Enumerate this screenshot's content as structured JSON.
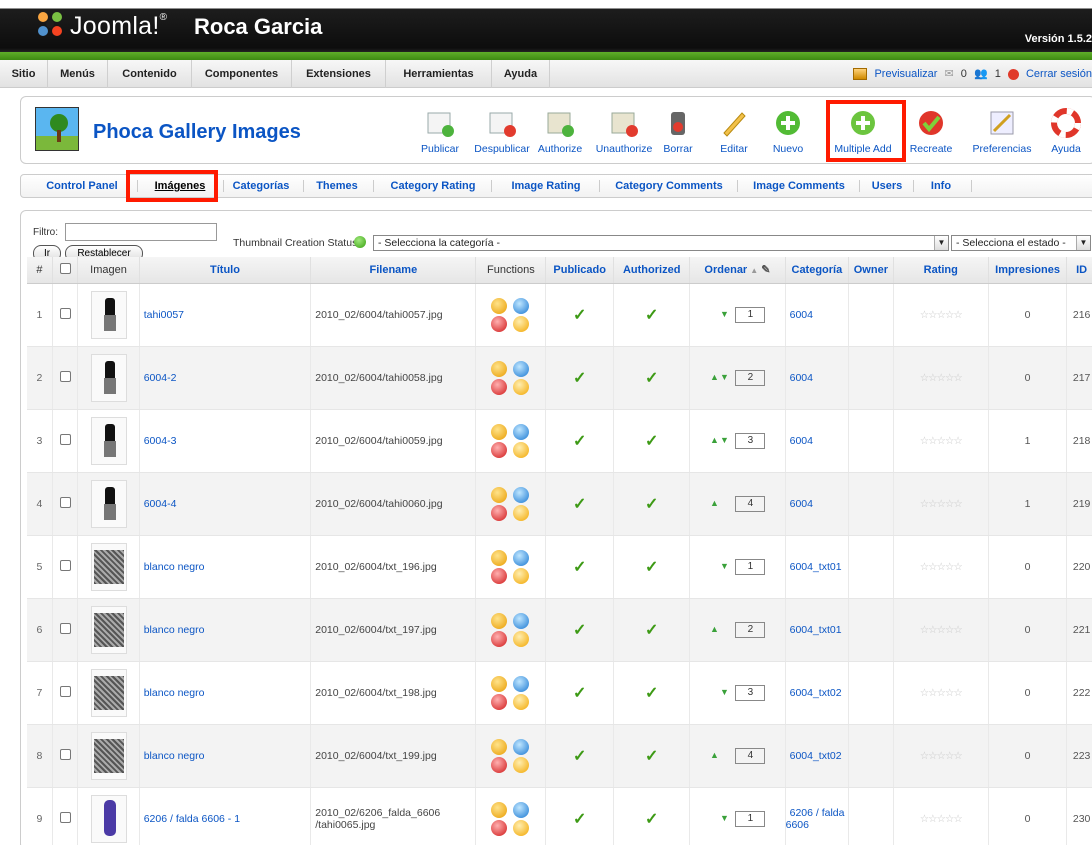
{
  "header": {
    "logo_text": "Joomla!",
    "site_name": "Roca Garcia",
    "version": "Versión 1.5.2"
  },
  "menubar": {
    "items": [
      "Sitio",
      "Menús",
      "Contenido",
      "Componentes",
      "Extensiones",
      "Herramientas",
      "Ayuda"
    ],
    "preview": "Previsualizar",
    "messages_count": "0",
    "users_count": "1",
    "logout": "Cerrar sesión"
  },
  "toolbar": {
    "title": "Phoca Gallery Images",
    "buttons": [
      "Publicar",
      "Despublicar",
      "Authorize",
      "Unauthorize",
      "Borrar",
      "Editar",
      "Nuevo",
      "Multiple Add",
      "Recreate",
      "Preferencias",
      "Ayuda"
    ]
  },
  "submenu": {
    "items": [
      "Control Panel",
      "Imágenes",
      "Categorías",
      "Themes",
      "Category Rating",
      "Image Rating",
      "Category Comments",
      "Image Comments",
      "Users",
      "Info"
    ],
    "active": "Imágenes"
  },
  "filter": {
    "label": "Filtro:",
    "value": "",
    "go_label": "Ir",
    "reset_label": "Restablecer",
    "thumb_status_label": "Thumbnail Creation Status:",
    "category_select": "- Selecciona la categoría -",
    "state_select": "- Selecciona el estado -"
  },
  "table": {
    "columns": [
      "#",
      "",
      "Imagen",
      "Título",
      "Filename",
      "Functions",
      "Publicado",
      "Authorized",
      "Ordenar",
      "Categoría",
      "Owner",
      "Rating",
      "Impresiones",
      "ID"
    ],
    "rows": [
      {
        "n": "1",
        "title": "tahi0057",
        "filename": "2010_02/6004/tahi0057.jpg",
        "up": false,
        "down": true,
        "order": "1",
        "category": "6004",
        "owner": "",
        "impressions": "0",
        "id": "216",
        "thumb": "dress"
      },
      {
        "n": "2",
        "title": "6004-2",
        "filename": "2010_02/6004/tahi0058.jpg",
        "up": true,
        "down": true,
        "order": "2",
        "category": "6004",
        "owner": "",
        "impressions": "0",
        "id": "217",
        "thumb": "dress"
      },
      {
        "n": "3",
        "title": "6004-3",
        "filename": "2010_02/6004/tahi0059.jpg",
        "up": true,
        "down": true,
        "order": "3",
        "category": "6004",
        "owner": "",
        "impressions": "1",
        "id": "218",
        "thumb": "dress"
      },
      {
        "n": "4",
        "title": "6004-4",
        "filename": "2010_02/6004/tahi0060.jpg",
        "up": true,
        "down": false,
        "order": "4",
        "category": "6004",
        "owner": "",
        "impressions": "1",
        "id": "219",
        "thumb": "dress"
      },
      {
        "n": "5",
        "title": "blanco negro",
        "filename": "2010_02/6004/txt_196.jpg",
        "up": false,
        "down": true,
        "order": "1",
        "category": "6004_txt01",
        "owner": "",
        "impressions": "0",
        "id": "220",
        "thumb": "fabric"
      },
      {
        "n": "6",
        "title": "blanco negro",
        "filename": "2010_02/6004/txt_197.jpg",
        "up": true,
        "down": false,
        "order": "2",
        "category": "6004_txt01",
        "owner": "",
        "impressions": "0",
        "id": "221",
        "thumb": "fabric"
      },
      {
        "n": "7",
        "title": "blanco negro",
        "filename": "2010_02/6004/txt_198.jpg",
        "up": false,
        "down": true,
        "order": "3",
        "category": "6004_txt02",
        "owner": "",
        "impressions": "0",
        "id": "222",
        "thumb": "fabric"
      },
      {
        "n": "8",
        "title": "blanco negro",
        "filename": "2010_02/6004/txt_199.jpg",
        "up": true,
        "down": false,
        "order": "4",
        "category": "6004_txt02",
        "owner": "",
        "impressions": "0",
        "id": "223",
        "thumb": "fabric"
      },
      {
        "n": "9",
        "title": "6206 / falda 6606 - 1",
        "filename": "2010_02/6206_falda_6606 /tahi0065.jpg",
        "up": false,
        "down": true,
        "order": "1",
        "category": "6206 / falda 6606",
        "owner": "",
        "impressions": "0",
        "id": "230",
        "thumb": "purple"
      }
    ]
  },
  "colors": {
    "link": "#0b55c4",
    "highlight": "#ff1a00",
    "header_bg": "#0d0d0d",
    "header_stripe": "#5fae29"
  }
}
